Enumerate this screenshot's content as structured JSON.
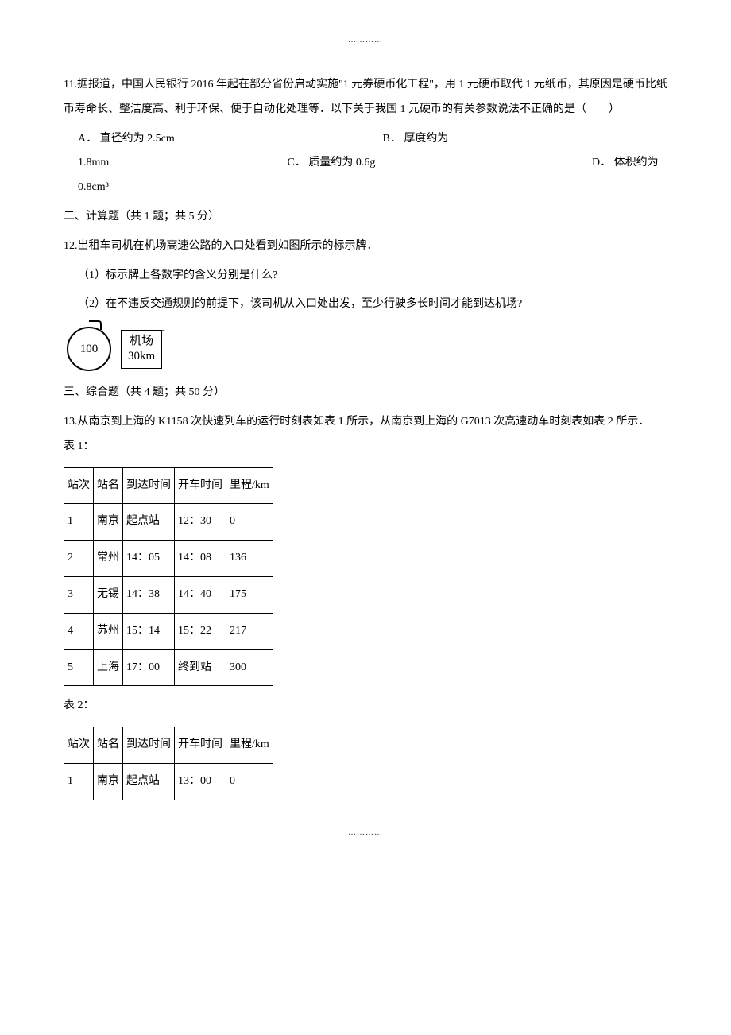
{
  "decor": {
    "dots": "…………"
  },
  "q11": {
    "text": "11.据报道，中国人民银行 2016 年起在部分省份启动实施\"1 元券硬币化工程\"，用 1 元硬币取代 1 元纸币，其原因是硬币比纸币寿命长、整洁度高、利于环保、便于自动化处理等．以下关于我国 1 元硬币的有关参数说法不正确的是（  ）",
    "optA_label": "A． 直径约为 2.5cm",
    "optB_label": "B． 厚度约为",
    "optB_cont": "1.8mm",
    "optC_label": "C． 质量约为 0.6g",
    "optD_label": "D． 体积约为",
    "optD_cont": "0.8cm³"
  },
  "section2": {
    "title": "二、计算题（共 1 题；共 5 分）"
  },
  "q12": {
    "text": "12.出租车司机在机场高速公路的入口处看到如图所示的标示牌．",
    "p1": "（1）标示牌上各数字的含义分别是什么?",
    "p2": "（2）在不违反交通规则的前提下，该司机从入口处出发，至少行驶多长时间才能到达机场?",
    "sign_speed": "100",
    "sign_dest": "机场",
    "sign_dist": "30km"
  },
  "section3": {
    "title": "三、综合题（共 4 题；共 50 分）"
  },
  "q13": {
    "text": "13.从南京到上海的 K1158 次快速列车的运行时刻表如表 1 所示，从南京到上海的 G7013 次高速动车时刻表如表 2 所示．  表 1：",
    "table1": {
      "head": [
        "站次",
        "站名",
        "到达时间",
        "开车时间",
        "里程/km"
      ],
      "rows": [
        [
          "1",
          "南京",
          "起点站",
          "12：30",
          "0"
        ],
        [
          "2",
          "常州",
          "14：05",
          "14：08",
          "136"
        ],
        [
          "3",
          "无锡",
          "14：38",
          "14：40",
          "175"
        ],
        [
          "4",
          "苏州",
          "15：14",
          "15：22",
          "217"
        ],
        [
          "5",
          "上海",
          "17：00",
          "终到站",
          "300"
        ]
      ]
    },
    "table2_caption": "表 2：",
    "table2": {
      "head": [
        "站次",
        "站名",
        "到达时间",
        "开车时间",
        "里程/km"
      ],
      "rows": [
        [
          "1",
          "南京",
          "起点站",
          "13：00",
          "0"
        ]
      ]
    }
  }
}
